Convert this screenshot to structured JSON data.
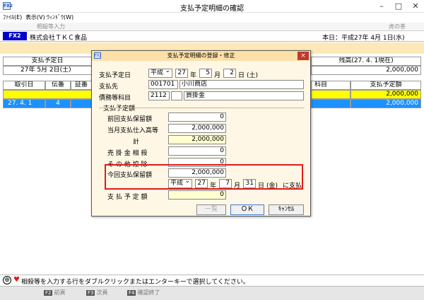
{
  "window": {
    "title": "支払予定明細の確認",
    "icon": "FX2"
  },
  "menu": [
    "ﾌｧｲﾙ(E)",
    "表示(V)",
    "ｳｨﾝﾄﾞｳ(W)"
  ],
  "toolbar": {
    "left": "相殺等入力",
    "right": "虎の巻"
  },
  "header": {
    "tag": "FX2",
    "company": "株式会社ＴＫＣ食品",
    "today": "本日：平成27年 4月 1日(水)"
  },
  "grid_top": {
    "col1_header": "支払予定日",
    "col1_value": "27年 5月 2日(土)",
    "right_header": "残高(27. 4. 1現在)",
    "right_value": "2,000,000"
  },
  "grid": {
    "headers": [
      "取引日",
      "伝番",
      "証番",
      "科目",
      "支払予定額"
    ],
    "rows": [
      {
        "date": "",
        "den": "",
        "amount": "2,000,000",
        "highlight": "yellow"
      },
      {
        "date": "27. 4. 1",
        "den": "4",
        "amount": "2,000,000",
        "highlight": "blue"
      }
    ]
  },
  "dialog": {
    "title": "支払予定明細の登録・修正",
    "icon": "FX2",
    "close": "×",
    "payment_date": {
      "label": "支払予定日",
      "era": "平成",
      "year": "27",
      "year_unit": "年",
      "month": "5",
      "month_unit": "月",
      "day": "2",
      "day_unit": "日",
      "weekday": "(土)"
    },
    "payee": {
      "label": "支払先",
      "code": "001701",
      "name": "小川商店"
    },
    "account": {
      "label": "債務等科目",
      "code": "2112",
      "name": "買掛金"
    },
    "section_label": "支払予定額",
    "prev_retained": {
      "label": "前回支払保留額",
      "value": "0"
    },
    "current_purchase": {
      "label": "当月支払仕入高等",
      "value": "2,000,000"
    },
    "subtotal": {
      "label": "計",
      "value": "2,000,000"
    },
    "ar_offset": {
      "label": "売 掛 金 相 殺",
      "value": "0"
    },
    "other_deduction": {
      "label": "そ の 他 控 除",
      "value": "0"
    },
    "current_retained": {
      "label": "今回支払保留額",
      "value": "2,000,000"
    },
    "retained_pay_date": {
      "era": "平成",
      "year": "27",
      "year_unit": "年",
      "month": "7",
      "month_unit": "月",
      "day": "31",
      "day_unit": "日",
      "weekday": "(金)",
      "suffix": "に支払"
    },
    "scheduled_amount": {
      "label": "支 払 予 定 額",
      "value": "0"
    },
    "buttons": {
      "list": "一覧",
      "ok": "ＯＫ",
      "cancel": "ｷｬﾝｾﾙ"
    }
  },
  "status": {
    "message": "相殺等を入力する行をダブルクリックまたはエンターキーで選択してください。"
  },
  "fkeys": [
    {
      "key": "F2",
      "label": "前頁"
    },
    {
      "key": "F3",
      "label": "次頁"
    },
    {
      "key": "F4",
      "label": "確認終了"
    }
  ],
  "colors": {
    "highlight_yellow": "#ffff00",
    "highlight_blue": "#1e90ff",
    "emphasis_red": "#e21a1a",
    "tag_blue": "#0000cc"
  }
}
